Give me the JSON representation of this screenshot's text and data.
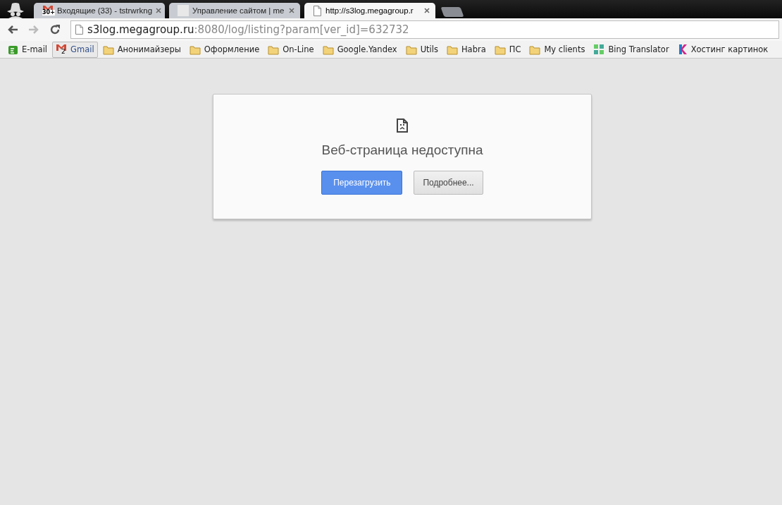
{
  "tabs": [
    {
      "kind": "gmail",
      "badge": "30+",
      "title": "Входящие (33) - tstrwrkng",
      "selected": false
    },
    {
      "kind": "blank",
      "title": "Управление сайтом | me",
      "selected": false
    },
    {
      "kind": "page",
      "title": "http://s3log.megagroup.r",
      "selected": true
    }
  ],
  "address": {
    "host": "s3log.megagroup.ru",
    "rest": ":8080/log/listing?param[ver_id]=632732"
  },
  "bookmarks": [
    {
      "kind": "email",
      "label": "E-mail",
      "highlighted": false
    },
    {
      "kind": "gmail",
      "badge": "2",
      "label": "Gmail",
      "highlighted": true
    },
    {
      "kind": "folder",
      "label": "Анонимайзеры",
      "highlighted": false
    },
    {
      "kind": "folder",
      "label": "Оформление",
      "highlighted": false
    },
    {
      "kind": "folder",
      "label": "On-Line",
      "highlighted": false
    },
    {
      "kind": "folder",
      "label": "Google.Yandex",
      "highlighted": false
    },
    {
      "kind": "folder",
      "label": "Utils",
      "highlighted": false
    },
    {
      "kind": "folder",
      "label": "Habra",
      "highlighted": false
    },
    {
      "kind": "folder",
      "label": "ПС",
      "highlighted": false
    },
    {
      "kind": "folder",
      "label": "My clients",
      "highlighted": false
    },
    {
      "kind": "translator",
      "label": "Bing Translator",
      "highlighted": false
    },
    {
      "kind": "k",
      "label": "Хостинг картинок",
      "highlighted": false
    }
  ],
  "error": {
    "title": "Веб-страница недоступна",
    "buttons": [
      {
        "kind": "primary",
        "label": "Перезагрузить"
      },
      {
        "kind": "secondary",
        "label": "Подробнее..."
      }
    ]
  }
}
